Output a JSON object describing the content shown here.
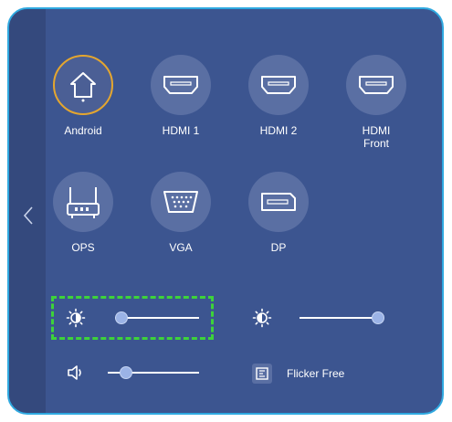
{
  "colors": {
    "panel_bg": "#3c5590",
    "panel_border": "#2fa9e0",
    "circle_bg": "#5a6fa3",
    "active_ring": "#e4a62f",
    "highlight": "#3dd33a",
    "knob": "#9bb3e6"
  },
  "nav": {
    "back_icon": "chevron-left-icon"
  },
  "sources": [
    {
      "label": "Android",
      "icon": "home-icon",
      "active": true
    },
    {
      "label": "HDMI 1",
      "icon": "hdmi-icon",
      "active": false
    },
    {
      "label": "HDMI 2",
      "icon": "hdmi-icon",
      "active": false
    },
    {
      "label": "HDMI\nFront",
      "icon": "hdmi-icon",
      "active": false
    },
    {
      "label": "OPS",
      "icon": "router-icon",
      "active": false
    },
    {
      "label": "VGA",
      "icon": "vga-icon",
      "active": false
    },
    {
      "label": "DP",
      "icon": "displayport-icon",
      "active": false
    }
  ],
  "controls": {
    "brightness": {
      "icon": "brightness-icon",
      "level": 0.08
    },
    "contrast": {
      "icon": "contrast-icon",
      "level": 1.0
    },
    "volume": {
      "icon": "volume-icon",
      "level": 0.2
    },
    "flicker_free": {
      "icon": "flicker-free-icon",
      "label": "Flicker Free"
    }
  }
}
